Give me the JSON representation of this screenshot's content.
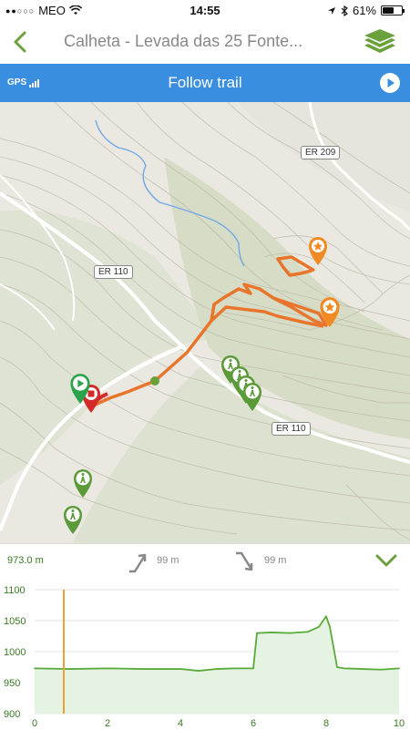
{
  "status_bar": {
    "carrier": "MEO",
    "time": "14:55",
    "battery": "61%",
    "battery_level": 0.61
  },
  "nav": {
    "title": "Calheta - Levada das 25 Fonte..."
  },
  "gps_bar": {
    "label": "GPS",
    "title": "Follow trail"
  },
  "map": {
    "road_labels": [
      "ER 209",
      "ER 110",
      "ER 110"
    ]
  },
  "profile": {
    "current_altitude": "973.0 m",
    "ascent": "99 m",
    "descent": "99 m",
    "accent_color": "#3a7a25"
  },
  "chart_data": {
    "type": "area",
    "xlim": [
      0,
      10
    ],
    "ylim": [
      900,
      1100
    ],
    "x_ticks": [
      "0",
      "2",
      "4",
      "6",
      "8",
      "10"
    ],
    "y_ticks": [
      "1100",
      "1050",
      "1000",
      "950",
      "900"
    ],
    "x": [
      0,
      1,
      2,
      3,
      4,
      4.5,
      5,
      5.5,
      6.0,
      6.1,
      6.5,
      7,
      7.5,
      7.8,
      8.0,
      8.1,
      8.3,
      8.5,
      9,
      9.5,
      10
    ],
    "values": [
      973,
      972,
      973,
      972,
      972,
      969,
      972,
      973,
      973,
      1030,
      1031,
      1030,
      1032,
      1040,
      1057,
      1040,
      975,
      973,
      972,
      971,
      973
    ],
    "marker_x": 0.8,
    "fill_color": "#e4f3e2",
    "line_color": "#5aaa3a",
    "marker_color": "#f0a030"
  }
}
